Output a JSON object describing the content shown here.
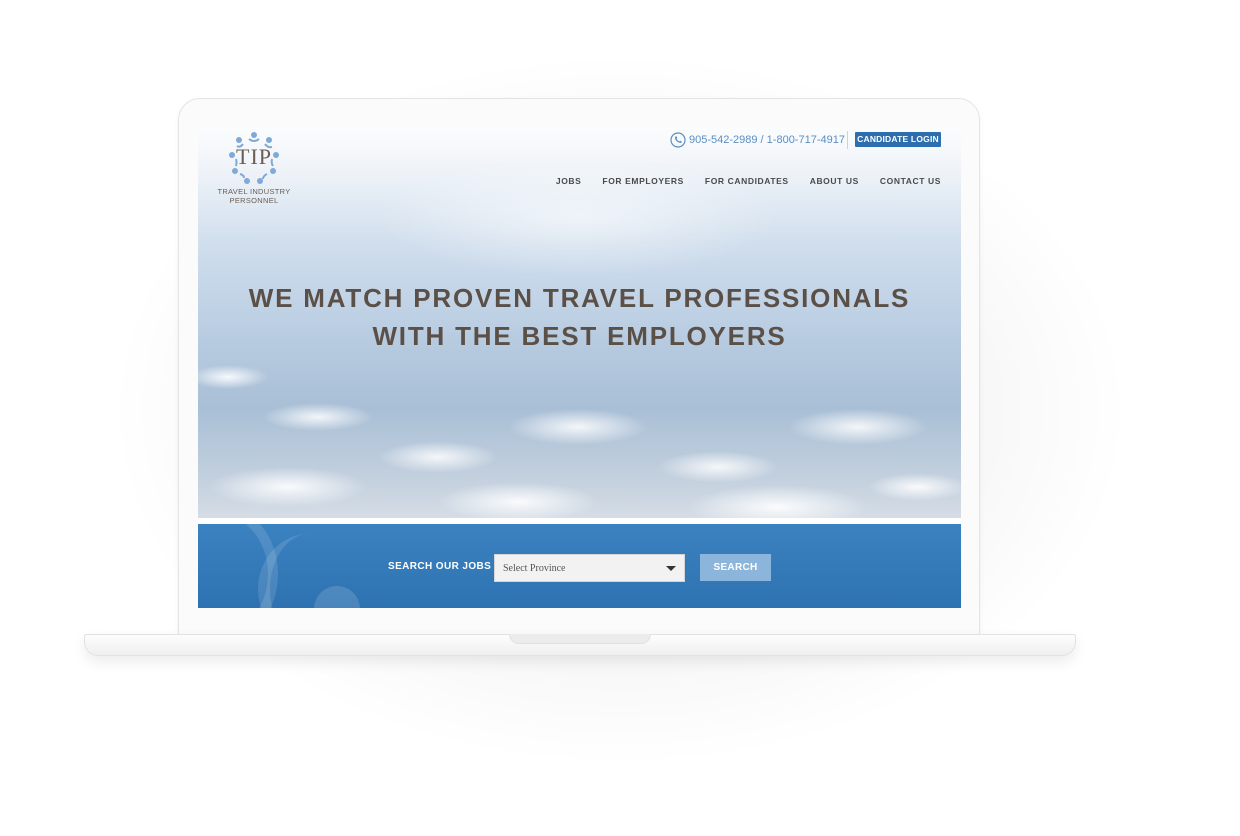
{
  "header": {
    "logo": {
      "mark_text": "TIP",
      "caption_line1": "TRAVEL INDUSTRY",
      "caption_line2": "PERSONNEL"
    },
    "phone": "905-542-2989 / 1-800-717-4917",
    "login_button": "CANDIDATE LOGIN"
  },
  "nav": {
    "items": [
      "JOBS",
      "FOR EMPLOYERS",
      "FOR CANDIDATES",
      "ABOUT US",
      "CONTACT US"
    ]
  },
  "hero": {
    "headline_line1": "WE MATCH PROVEN TRAVEL PROFESSIONALS",
    "headline_line2": "WITH THE BEST EMPLOYERS"
  },
  "search": {
    "label": "SEARCH OUR JOBS",
    "province_selected": "Select Province",
    "button": "SEARCH"
  },
  "colors": {
    "brand_blue": "#2c6eae",
    "band_blue": "#3b82c0",
    "search_button": "#8cb5dc",
    "headline": "#5b5048",
    "phone_text": "#5a8fc4"
  },
  "icons": {
    "phone": "phone-icon",
    "select_caret": "chevron-down-icon"
  }
}
